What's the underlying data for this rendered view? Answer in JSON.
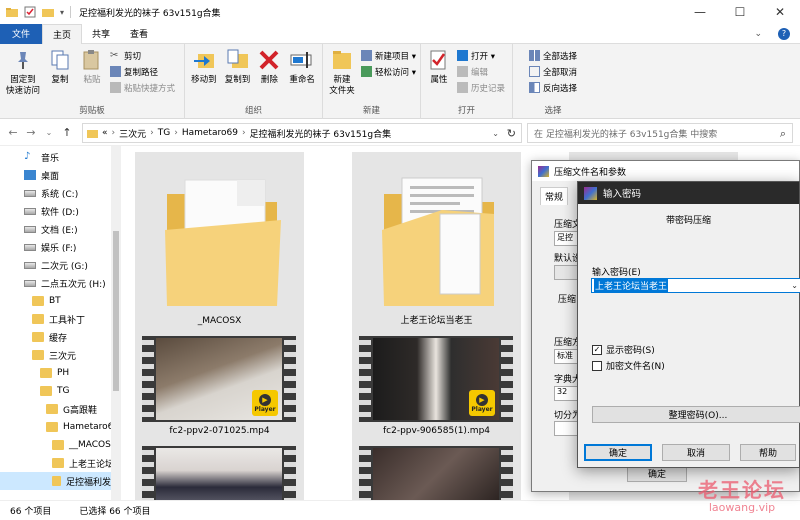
{
  "window": {
    "title": "足控福利发光的袜子 63v151g合集",
    "controls": [
      "—",
      "☐",
      "✕"
    ]
  },
  "ribbon_tabs": [
    "文件",
    "主页",
    "共享",
    "查看"
  ],
  "ribbon": {
    "clipboard": {
      "pin": "固定到\n快速访问",
      "copy": "复制",
      "paste": "粘贴",
      "cut": "剪切",
      "copy_path": "复制路径",
      "paste_shortcut": "粘贴快捷方式",
      "label": "剪贴板"
    },
    "organize": {
      "move_to": "移动到",
      "copy_to": "复制到",
      "delete": "删除",
      "rename": "重命名",
      "label": "组织"
    },
    "new": {
      "new_folder": "新建\n文件夹",
      "new_item": "新建项目 ▾",
      "easy_access": "轻松访问 ▾",
      "label": "新建"
    },
    "open": {
      "properties": "属性",
      "open": "打开 ▾",
      "edit": "编辑",
      "history": "历史记录",
      "label": "打开"
    },
    "select": {
      "select_all": "全部选择",
      "select_none": "全部取消",
      "invert": "反向选择",
      "label": "选择"
    }
  },
  "address": {
    "crumbs": [
      "«",
      "三次元",
      "TG",
      "Hametaro69",
      "足控福利发光的袜子 63v151g合集"
    ],
    "search_placeholder": "在 足控福利发光的袜子 63v151g合集 中搜索"
  },
  "nav": [
    {
      "label": "音乐",
      "icon": "music-icon",
      "indent": 0
    },
    {
      "label": "桌面",
      "icon": "desktop-icon",
      "indent": 0
    },
    {
      "label": "系统 (C:)",
      "icon": "drive-icon",
      "indent": 0
    },
    {
      "label": "软件 (D:)",
      "icon": "drive-icon",
      "indent": 0
    },
    {
      "label": "文档 (E:)",
      "icon": "drive-icon",
      "indent": 0
    },
    {
      "label": "娱乐 (F:)",
      "icon": "drive-icon",
      "indent": 0
    },
    {
      "label": "二次元 (G:)",
      "icon": "drive-icon",
      "indent": 0
    },
    {
      "label": "二点五次元 (H:)",
      "icon": "drive-icon",
      "indent": 0
    },
    {
      "label": "BT",
      "icon": "folder-icon",
      "indent": 1
    },
    {
      "label": "工具补丁",
      "icon": "folder-icon",
      "indent": 1
    },
    {
      "label": "缓存",
      "icon": "folder-icon",
      "indent": 1
    },
    {
      "label": "三次元",
      "icon": "folder-icon",
      "indent": 1
    },
    {
      "label": "PH",
      "icon": "folder-icon",
      "indent": 2
    },
    {
      "label": "TG",
      "icon": "folder-icon",
      "indent": 2
    },
    {
      "label": "G高跟鞋",
      "icon": "folder-icon",
      "indent": 3
    },
    {
      "label": "Hametaro6",
      "icon": "folder-icon",
      "indent": 3
    },
    {
      "label": "__MACOS",
      "icon": "folder-icon",
      "indent": 4
    },
    {
      "label": "上老王论坛",
      "icon": "folder-icon",
      "indent": 4
    },
    {
      "label": "足控福利发",
      "icon": "folder-icon",
      "indent": 4,
      "selected": true
    }
  ],
  "files": [
    {
      "name": "_MACOSX",
      "kind": "folder"
    },
    {
      "name": "上老王论坛当老王",
      "kind": "folder"
    },
    {
      "name": "fc2-ppv2-071025.mp4",
      "kind": "video",
      "badge": "Player"
    },
    {
      "name": "fc2-ppv-906585(1).mp4",
      "kind": "video",
      "badge": "Player"
    },
    {
      "name": "",
      "kind": "video"
    },
    {
      "name": "",
      "kind": "video"
    }
  ],
  "status": {
    "count": "66 个项目",
    "selected": "已选择 66 个项目"
  },
  "dialog_archive": {
    "title": "压缩文件名和参数",
    "tab": "常规",
    "labels": [
      "压缩文",
      "足控",
      "默认设",
      "压缩",
      "压缩方",
      "标准",
      "字典大",
      "32",
      "切分为"
    ],
    "ok": "确定"
  },
  "dialog_password": {
    "title": "输入密码",
    "heading": "带密码压缩",
    "field_label": "输入密码(E)",
    "field_value": "上老王论坛当老王",
    "show_password": "显示密码(S)",
    "show_password_checked": true,
    "encrypt_names": "加密文件名(N)",
    "encrypt_names_checked": false,
    "organize": "整理密码(O)...",
    "ok": "确定",
    "cancel": "取消",
    "help": "帮助"
  },
  "watermark": {
    "line1": "老王论坛",
    "line2": "laowang.vip"
  }
}
